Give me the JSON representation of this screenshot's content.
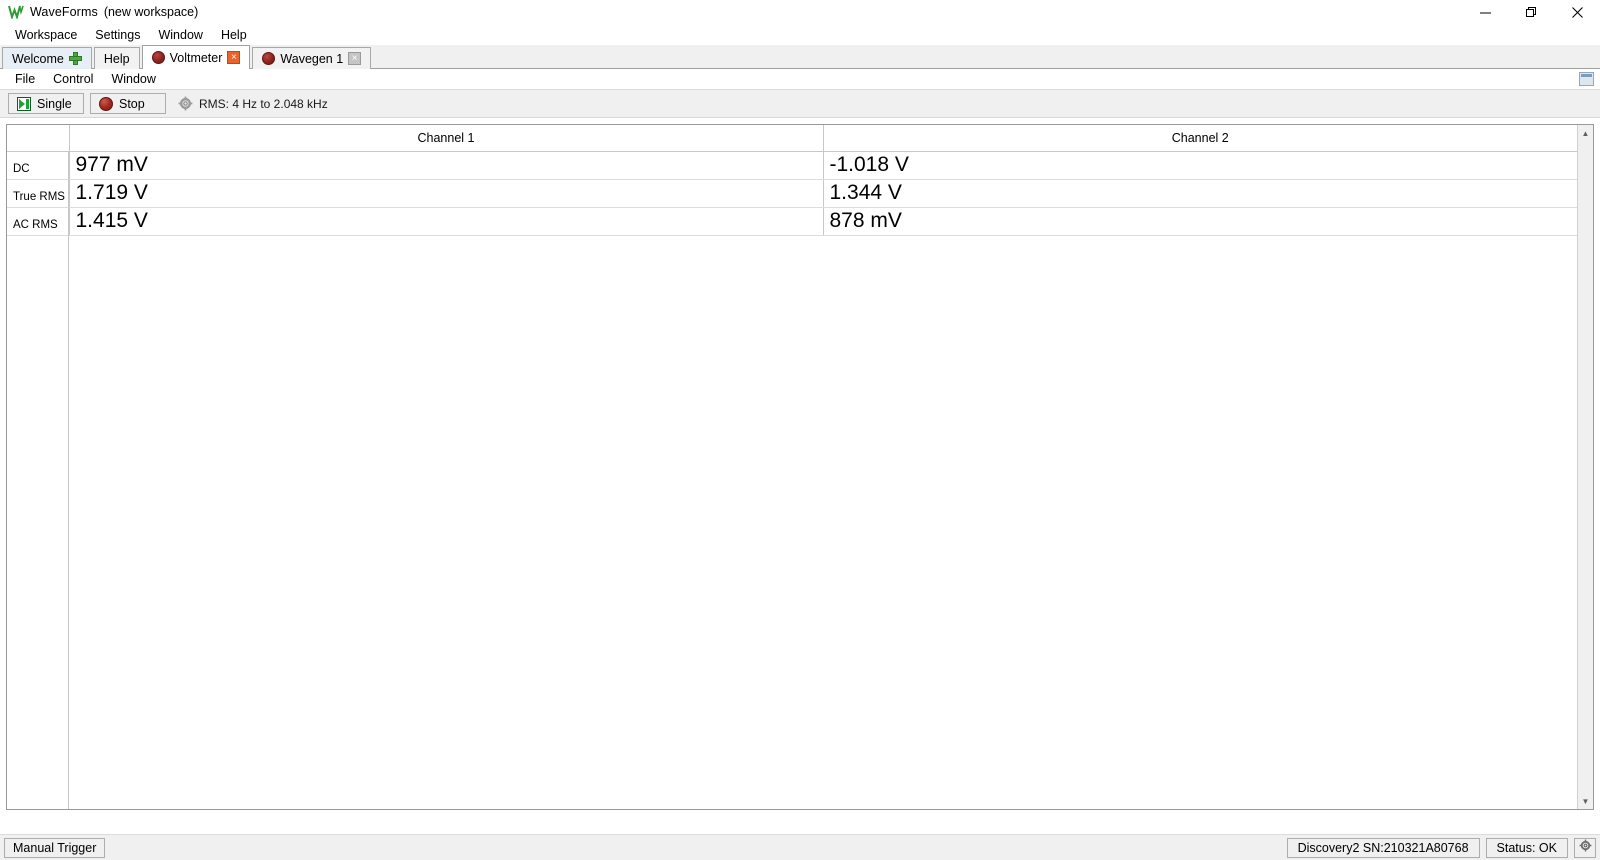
{
  "window": {
    "app_name": "WaveForms",
    "workspace": "(new workspace)",
    "logo_icon": "waveforms-logo-icon",
    "controls": {
      "minimize": "minimize-icon",
      "restore": "restore-icon",
      "close": "close-icon"
    }
  },
  "main_menu": [
    {
      "label": "Workspace"
    },
    {
      "label": "Settings"
    },
    {
      "label": "Window"
    },
    {
      "label": "Help"
    }
  ],
  "tabs": [
    {
      "label": "Welcome",
      "icon": "plus-icon",
      "type": "add",
      "active": false
    },
    {
      "label": "Help",
      "icon": "",
      "type": "plain",
      "active": false
    },
    {
      "label": "Voltmeter",
      "icon": "instrument-dot-icon",
      "type": "instrument",
      "active": true,
      "close": "×"
    },
    {
      "label": "Wavegen 1",
      "icon": "instrument-dot-icon",
      "type": "instrument",
      "active": false,
      "close": "×"
    }
  ],
  "panel_menu": [
    {
      "label": "File"
    },
    {
      "label": "Control"
    },
    {
      "label": "Window"
    }
  ],
  "panel_dock_icon": "dock-window-icon",
  "toolbar": {
    "single_label": "Single",
    "single_icon": "single-step-icon",
    "stop_label": "Stop",
    "stop_icon": "stop-icon",
    "info_icon": "gear-icon",
    "info_text": "RMS: 4 Hz to 2.048 kHz"
  },
  "measurements": {
    "columns": [
      "Channel 1",
      "Channel 2"
    ],
    "rows": [
      {
        "label": "DC",
        "values": [
          "977 mV",
          "-1.018 V"
        ]
      },
      {
        "label": "True RMS",
        "values": [
          "1.719 V",
          "1.344 V"
        ]
      },
      {
        "label": "AC RMS",
        "values": [
          "1.415 V",
          "878 mV"
        ]
      }
    ]
  },
  "scrollbar": {
    "up_arrow": "▲",
    "down_arrow": "▼"
  },
  "statusbar": {
    "manual_trigger_label": "Manual Trigger",
    "device": "Discovery2 SN:210321A80768",
    "status": "Status: OK",
    "settings_icon": "gear-icon"
  }
}
